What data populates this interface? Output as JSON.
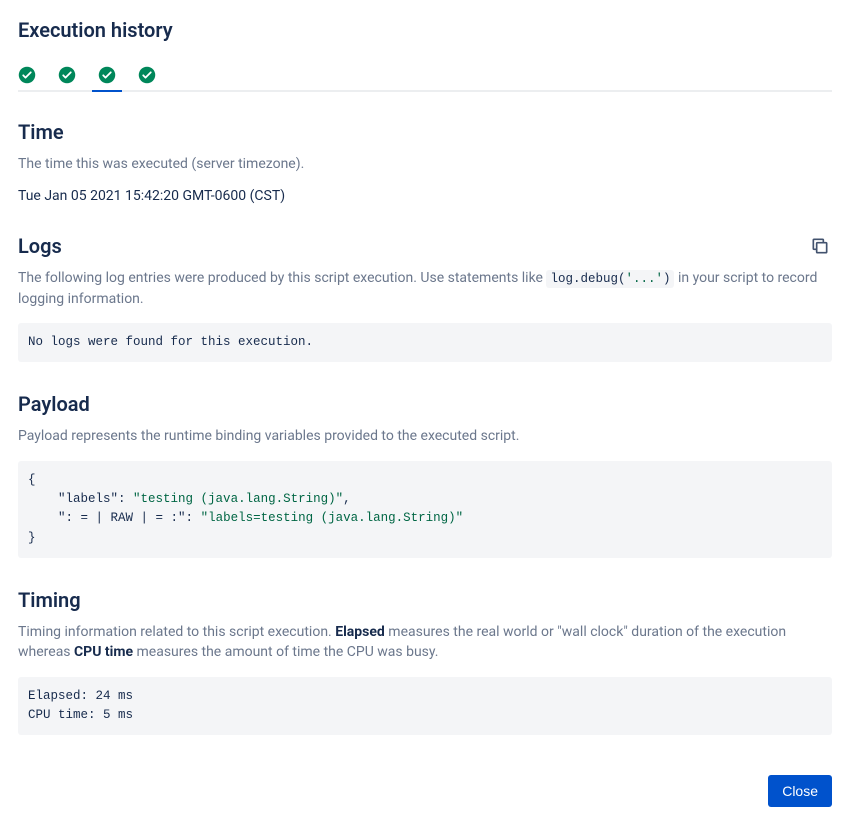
{
  "title": "Execution history",
  "tabs": [
    {
      "status": "success"
    },
    {
      "status": "success"
    },
    {
      "status": "success",
      "active": true
    },
    {
      "status": "success"
    }
  ],
  "time": {
    "heading": "Time",
    "helper": "The time this was executed (server timezone).",
    "value": "Tue Jan 05 2021 15:42:20 GMT-0600 (CST)"
  },
  "logs": {
    "heading": "Logs",
    "helper_prefix": "The following log entries were produced by this script execution. Use statements like ",
    "helper_code_fn": "log.debug(",
    "helper_code_arg": "'...'",
    "helper_code_close": ")",
    "helper_suffix": " in your script to record logging information.",
    "message": "No logs were found for this execution."
  },
  "payload": {
    "heading": "Payload",
    "helper": "Payload represents the runtime binding variables provided to the executed script.",
    "open": "{",
    "line1_key": "\"labels\"",
    "line1_val": "\"testing (java.lang.String)\"",
    "line1_comma": ",",
    "line2_key": "\": = | RAW | = :\"",
    "line2_val": "\"labels=testing (java.lang.String)\"",
    "close": "}"
  },
  "timing": {
    "heading": "Timing",
    "helper_p1": "Timing information related to this script execution. ",
    "bold1": "Elapsed",
    "helper_p2": " measures the real world or \"wall clock\" duration of the execution whereas ",
    "bold2": "CPU time",
    "helper_p3": " measures the amount of time the CPU was busy.",
    "elapsed_label": "Elapsed: ",
    "elapsed_value": "24 ms",
    "cpu_label": "CPU time: ",
    "cpu_value": "5 ms"
  },
  "footer": {
    "close_label": "Close"
  }
}
